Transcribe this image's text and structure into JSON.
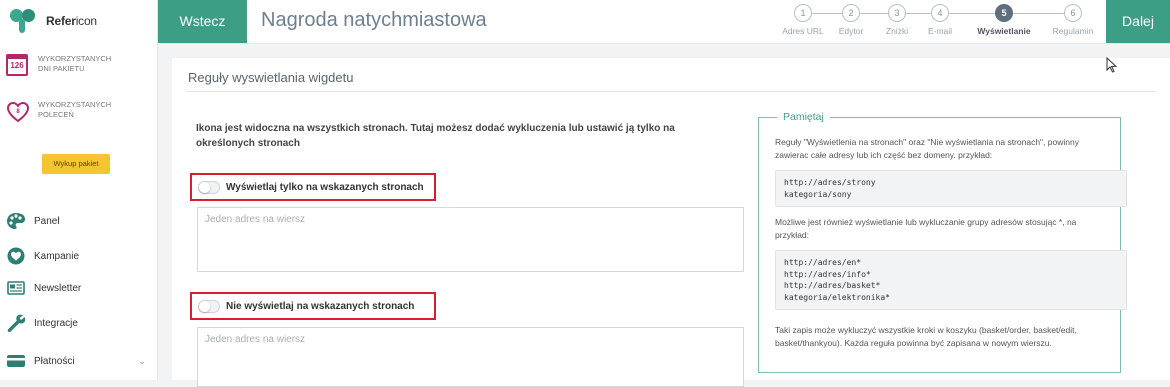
{
  "brand": {
    "name_bold": "Refer",
    "name_light": "icon"
  },
  "sidebar": {
    "days_counter": "126",
    "stat_days": "WYKORZYSTANYCH DNI PAKIETU",
    "stat_referrals_badge": "8",
    "stat_referrals": "WYKORZYSTANYCH POLECEŃ",
    "buy_button": "Wykup pakiet",
    "nav": [
      {
        "label": "Panel",
        "icon": "palette-icon"
      },
      {
        "label": "Kampanie",
        "icon": "heart-icon"
      },
      {
        "label": "Newsletter",
        "icon": "newspaper-icon"
      },
      {
        "label": "Integracje",
        "icon": "wrench-icon"
      },
      {
        "label": "Płatności",
        "icon": "wallet-icon"
      }
    ]
  },
  "header": {
    "back_label": "Wstecz",
    "title": "Nagroda natychmiastowa",
    "next_label": "Dalej",
    "steps": [
      {
        "num": "1",
        "label": "Adres URL",
        "active": false
      },
      {
        "num": "2",
        "label": "Edytor",
        "active": false
      },
      {
        "num": "3",
        "label": "Zniżki",
        "active": false
      },
      {
        "num": "4",
        "label": "E-mail",
        "active": false
      },
      {
        "num": "5",
        "label": "Wyświetlanie",
        "active": true
      },
      {
        "num": "6",
        "label": "Regulamin",
        "active": false
      }
    ]
  },
  "main": {
    "section_title": "Reguły wyswietlania wigdetu",
    "intro": "Ikona jest widoczna na wszystkich stronach. Tutaj możesz dodać wykluczenia lub ustawić ją tylko na określonych stronach",
    "show_only_label": "Wyświetlaj tylko na wskazanych stronach",
    "show_only_placeholder": "Jeden adres na wiersz",
    "hide_label": "Nie wyświetlaj na wskazanych stronach",
    "hide_placeholder": "Jeden adres na wiersz"
  },
  "remember": {
    "title": "Pamiętaj",
    "text1": "Reguły \"Wyświetlenia na stronach\" oraz \"Nie wyświetlania na stronach\", powinny zawierac całe adresy lub ich część bez domeny. przykład:",
    "code1": "http://adres/strony\nkategoria/sony",
    "text2": "Możliwe jest również wyświetlanie lub wykluczanie grupy adresów stosując *, na przykład:",
    "code2": "http://adres/en*\nhttp://adres/info*\nhttp://adres/basket*\nkategoria/elektronika*",
    "text3": "Taki zapis może wykluczyć wszystkie kroki w koszyku (basket/order, basket/edit, basket/thankyou). Każda reguła powinna być zapisana w nowym wierszu."
  },
  "colors": {
    "accent": "#3d9e86",
    "brand_pink": "#b3286a",
    "highlight_red": "#d81f2f",
    "buy_yellow": "#f5c431"
  }
}
